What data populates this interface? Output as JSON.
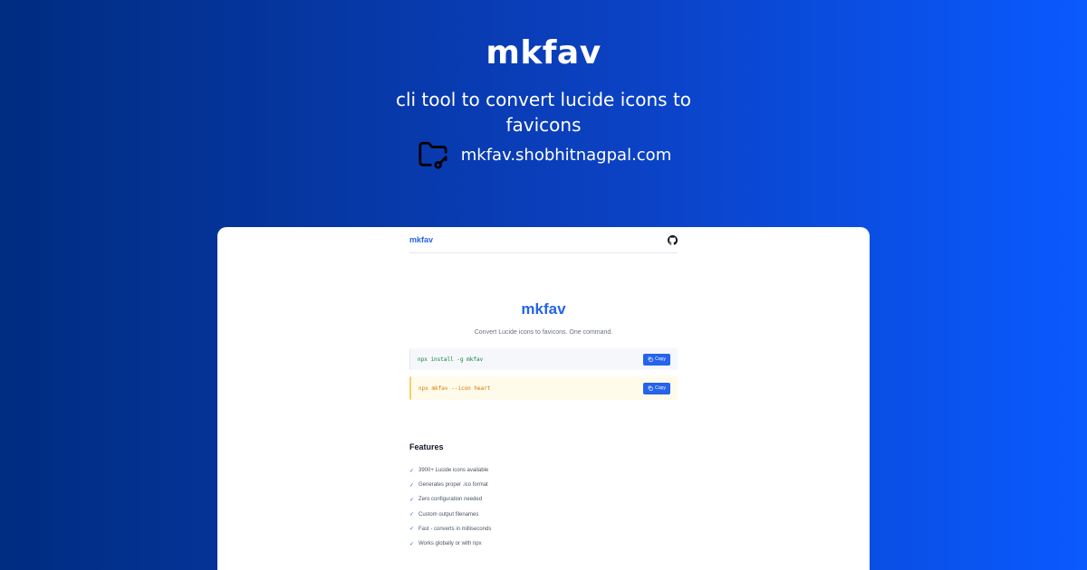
{
  "hero": {
    "title": "mkfav",
    "subtitle": "cli tool to convert lucide icons to favicons",
    "url": "mkfav.shobhitnagpal.com",
    "url_icon": "folder-key-icon"
  },
  "site": {
    "nav": {
      "logo": "mkfav",
      "github_icon": "github-icon"
    },
    "title": "mkfav",
    "tagline": "Convert Lucide icons to favicons. One command.",
    "commands": [
      {
        "text": "npx install -g mkfav",
        "copy_label": "Copy"
      },
      {
        "text": "npx mkfav --icon heart",
        "copy_label": "Copy"
      }
    ],
    "features_title": "Features",
    "features": [
      "3900+ Lucide icons available",
      "Generates proper .ico format",
      "Zero configuration needed",
      "Custom output filenames",
      "Fast - converts in milliseconds",
      "Works globally or with npx"
    ],
    "check_glyph": "✓"
  },
  "colors": {
    "accent": "#2563eb",
    "install_text": "#15803d",
    "run_text": "#d97706"
  }
}
